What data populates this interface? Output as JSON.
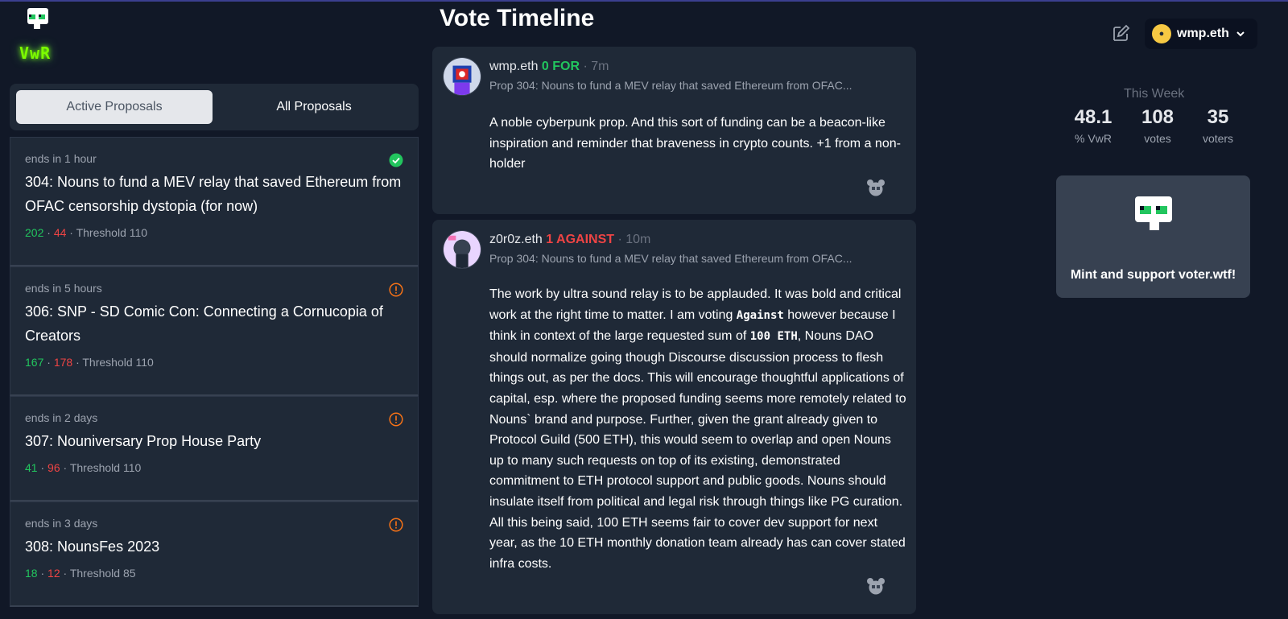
{
  "brand": {
    "logo_text": "VwR"
  },
  "tabs": [
    {
      "label": "Active Proposals",
      "active": true
    },
    {
      "label": "All Proposals",
      "active": false
    }
  ],
  "proposals": [
    {
      "ends": "ends in 1 hour",
      "title": "304: Nouns to fund a MEV relay that saved Ethereum from OFAC censorship dystopia (for now)",
      "for": "202",
      "against": "44",
      "threshold": "Threshold 110",
      "status": "check"
    },
    {
      "ends": "ends in 5 hours",
      "title": "306: SNP - SD Comic Con: Connecting a Cornucopia of Creators",
      "for": "167",
      "against": "178",
      "threshold": "Threshold 110",
      "status": "warning"
    },
    {
      "ends": "ends in 2 days",
      "title": "307: Nouniversary Prop House Party",
      "for": "41",
      "against": "96",
      "threshold": "Threshold 110",
      "status": "warning"
    },
    {
      "ends": "ends in 3 days",
      "title": "308: NounsFes 2023",
      "for": "18",
      "against": "12",
      "threshold": "Threshold 85",
      "status": "warning"
    }
  ],
  "timeline": {
    "title": "Vote Timeline",
    "votes": [
      {
        "voter": "wmp.eth",
        "vote": "0 FOR",
        "time": "7m",
        "proposal": "Prop 304: Nouns to fund a MEV relay that saved Ethereum from OFAC...",
        "body": [
          "A noble cyberpunk prop. And this sort of funding can be a beacon-like inspiration and reminder that braveness in crypto counts. +1 from a non-holder"
        ]
      },
      {
        "voter": "z0r0z.eth",
        "vote": "1 AGAINST",
        "time": "10m",
        "proposal": "Prop 304: Nouns to fund a MEV relay that saved Ethereum from OFAC...",
        "body_a": "The work by ultra sound relay is to be applauded. It was bold and critical work at the right time to matter. I am voting ",
        "code1": "Against",
        "body_b": " however because I think in context of the large requested sum of ",
        "code2": "100 ETH",
        "body_c": ", Nouns DAO should normalize going though Discourse discussion process to flesh things out, as per the docs. This will encourage thoughtful applications of capital, esp. where the proposed funding seems more remotely related to Nouns` brand and purpose. Further, given the grant already given to Protocol Guild (500 ETH), this would seem to overlap and open Nouns up to many such requests on top of its existing, demonstrated commitment to ETH protocol support and public goods. Nouns should insulate itself from political and legal risk through things like PG curation. All this being said, 100 ETH seems fair to cover dev support for next year, as the 10 ETH monthly donation team already has can cover stated infra costs."
      }
    ]
  },
  "account": {
    "name": "wmp.eth"
  },
  "week": {
    "label": "This Week",
    "stats": [
      {
        "num": "48.1",
        "label": "% VwR"
      },
      {
        "num": "108",
        "label": "votes"
      },
      {
        "num": "35",
        "label": "voters"
      }
    ]
  },
  "mint": {
    "label": "Mint and support voter.wtf!"
  },
  "colors": {
    "for": "#22c55e",
    "against": "#ef4444",
    "accent_glow": "#7cfc00",
    "warning": "#f97316"
  }
}
